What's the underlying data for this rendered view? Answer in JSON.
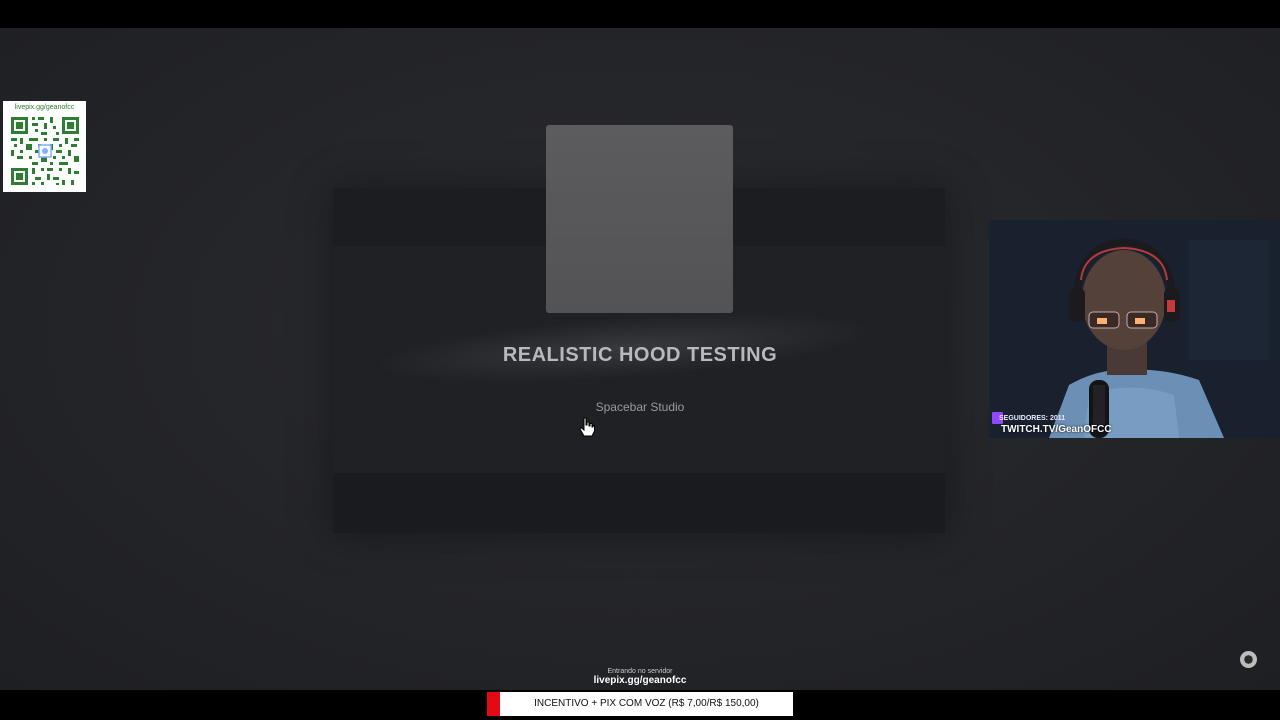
{
  "game": {
    "title": "REALISTIC HOOD TESTING",
    "creator": "Spacebar Studio"
  },
  "overlay": {
    "qr_url": "livepix.gg/geanofcc",
    "followers": "SEGUIDORES: 2011",
    "channel": "TWITCH.TV/GeanOFCC",
    "connecting": "Entrando no servidor",
    "livepix_url": "livepix.gg/geanofcc",
    "incentive": "INCENTIVO + PIX COM VOZ (R$ 7,00/R$ 150,00)"
  },
  "colors": {
    "background": "#25262a",
    "accent_red": "#e50914",
    "qr_green": "#2e7d32",
    "twitch_purple": "#9146ff"
  },
  "icons": {
    "cursor": "hand-pointer-icon",
    "spinner": "loading-spinner-icon",
    "twitch": "twitch-logo-icon"
  }
}
